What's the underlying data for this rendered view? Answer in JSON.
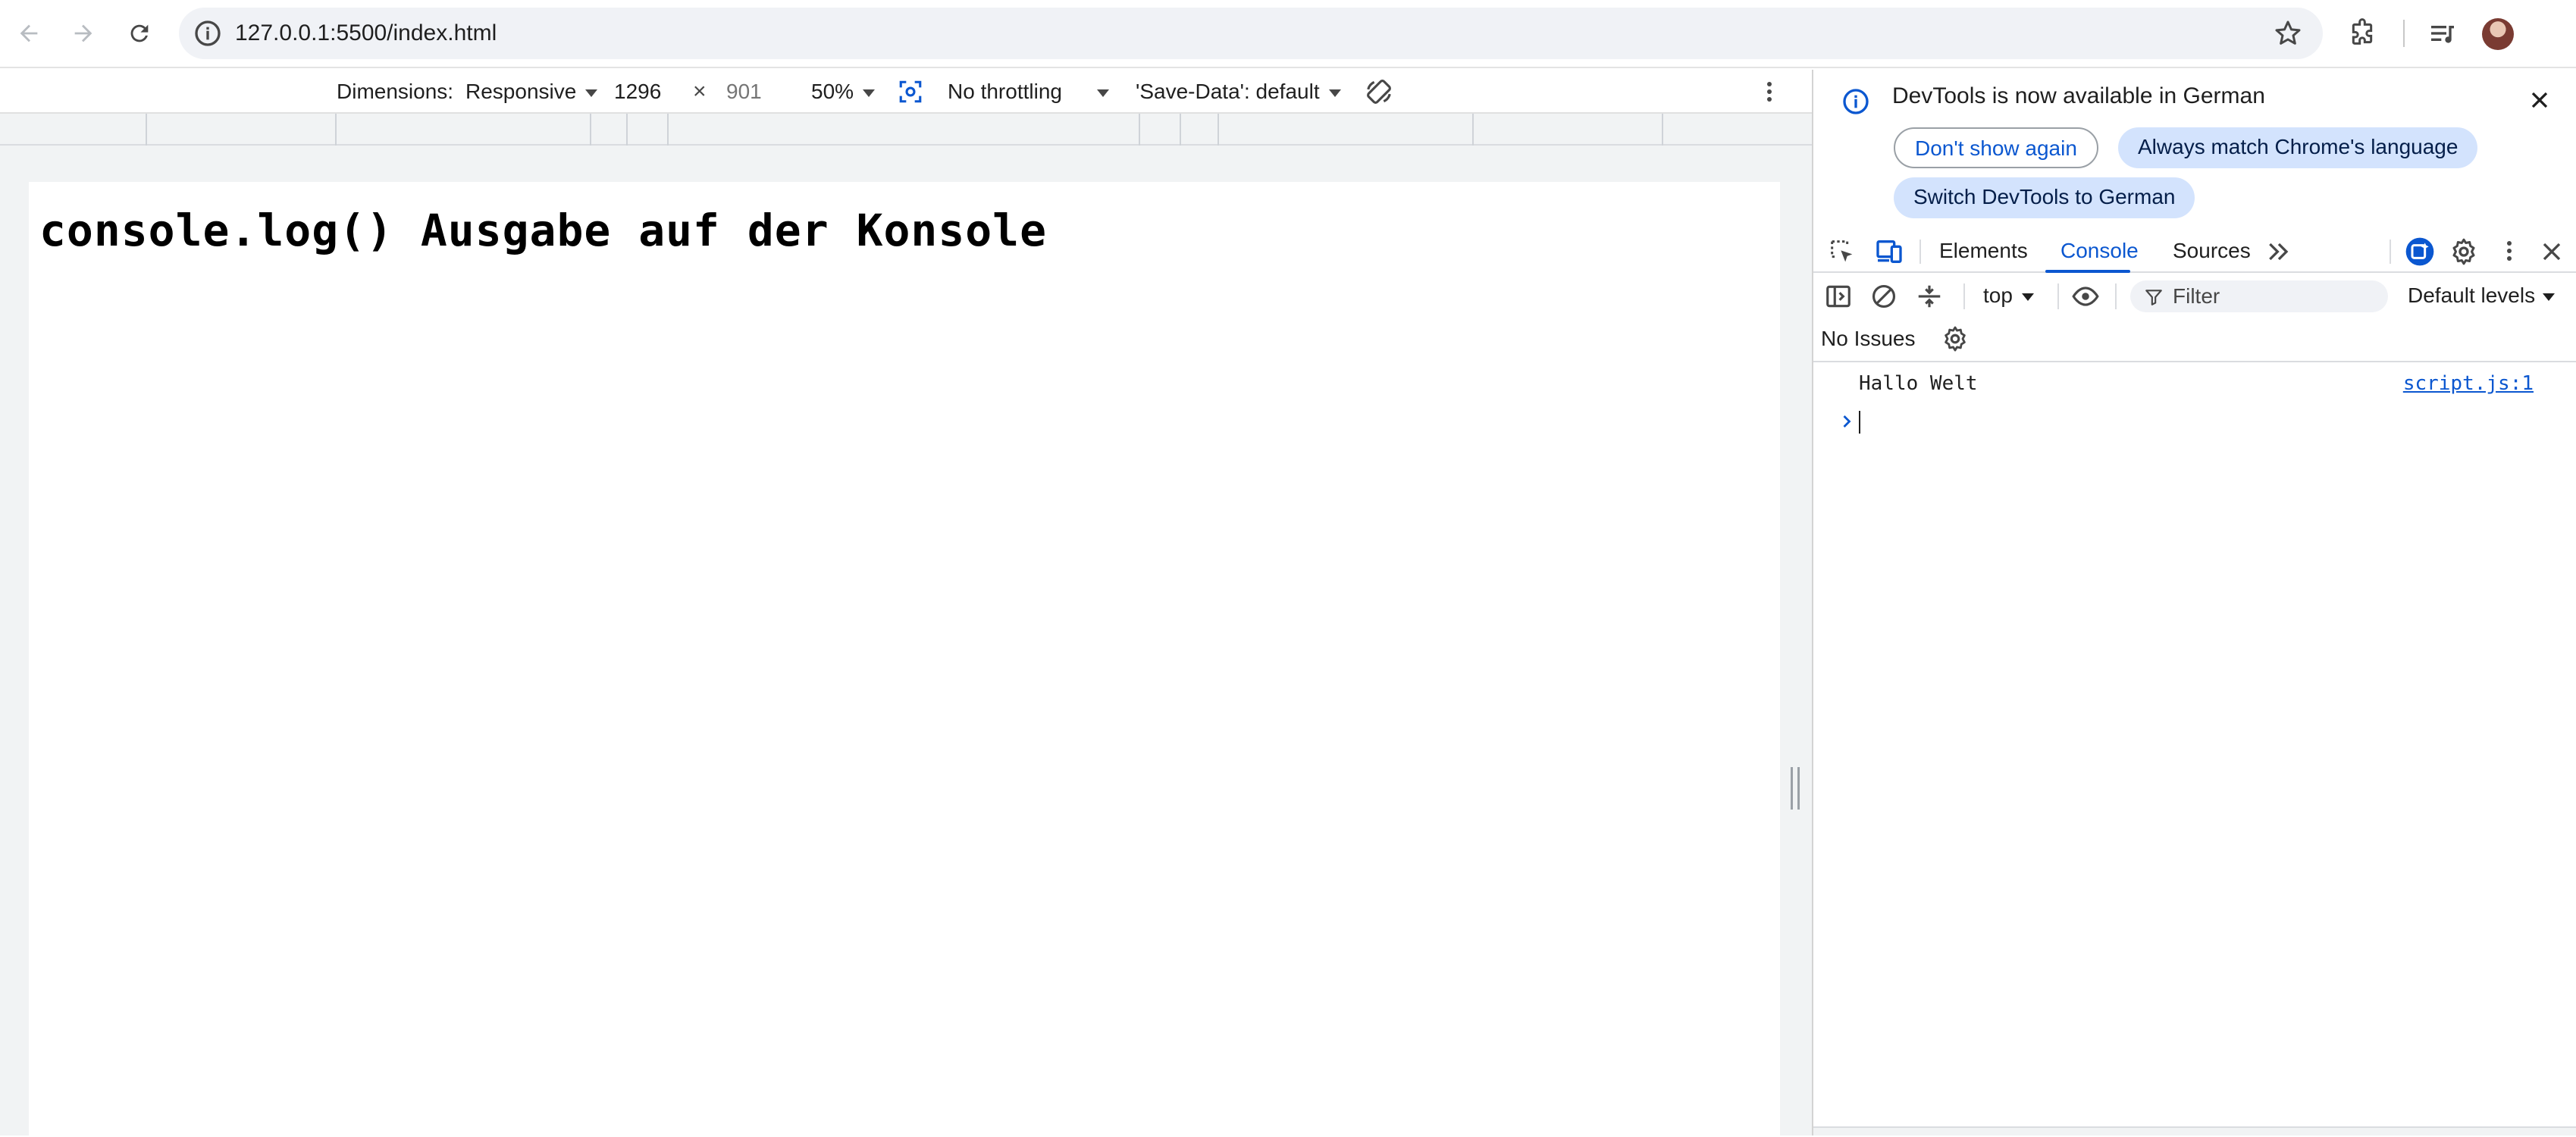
{
  "browser": {
    "url": "127.0.0.1:5500/index.html",
    "icons": [
      "back-icon",
      "forward-icon",
      "reload-icon",
      "site-info-icon",
      "bookmark-star-icon",
      "extensions-icon",
      "media-controls-icon",
      "profile-avatar"
    ]
  },
  "emulation": {
    "dimensions_label": "Dimensions:",
    "device": "Responsive",
    "width": "1296",
    "times": "×",
    "height": "901",
    "zoom": "50%",
    "throttling": "No throttling",
    "save_data": "'Save-Data': default"
  },
  "page": {
    "heading": "console.log() Ausgabe auf der Konsole"
  },
  "devtools": {
    "infobar": {
      "message": "DevTools is now available in German",
      "dont_show": "Don't show again",
      "always_match": "Always match Chrome's language",
      "switch": "Switch DevTools to German"
    },
    "tabs": [
      "Elements",
      "Console",
      "Sources"
    ],
    "active_tab": "Console",
    "console": {
      "context": "top",
      "filter_placeholder": "Filter",
      "levels": "Default levels",
      "issues": "No Issues",
      "messages": [
        {
          "text": "Hallo Welt",
          "source": "script.js:1"
        }
      ]
    }
  },
  "colors": {
    "accent": "#0b57d0",
    "tonal_button": "#d3e3fd",
    "omnibox_bg": "#f0f2f6"
  }
}
